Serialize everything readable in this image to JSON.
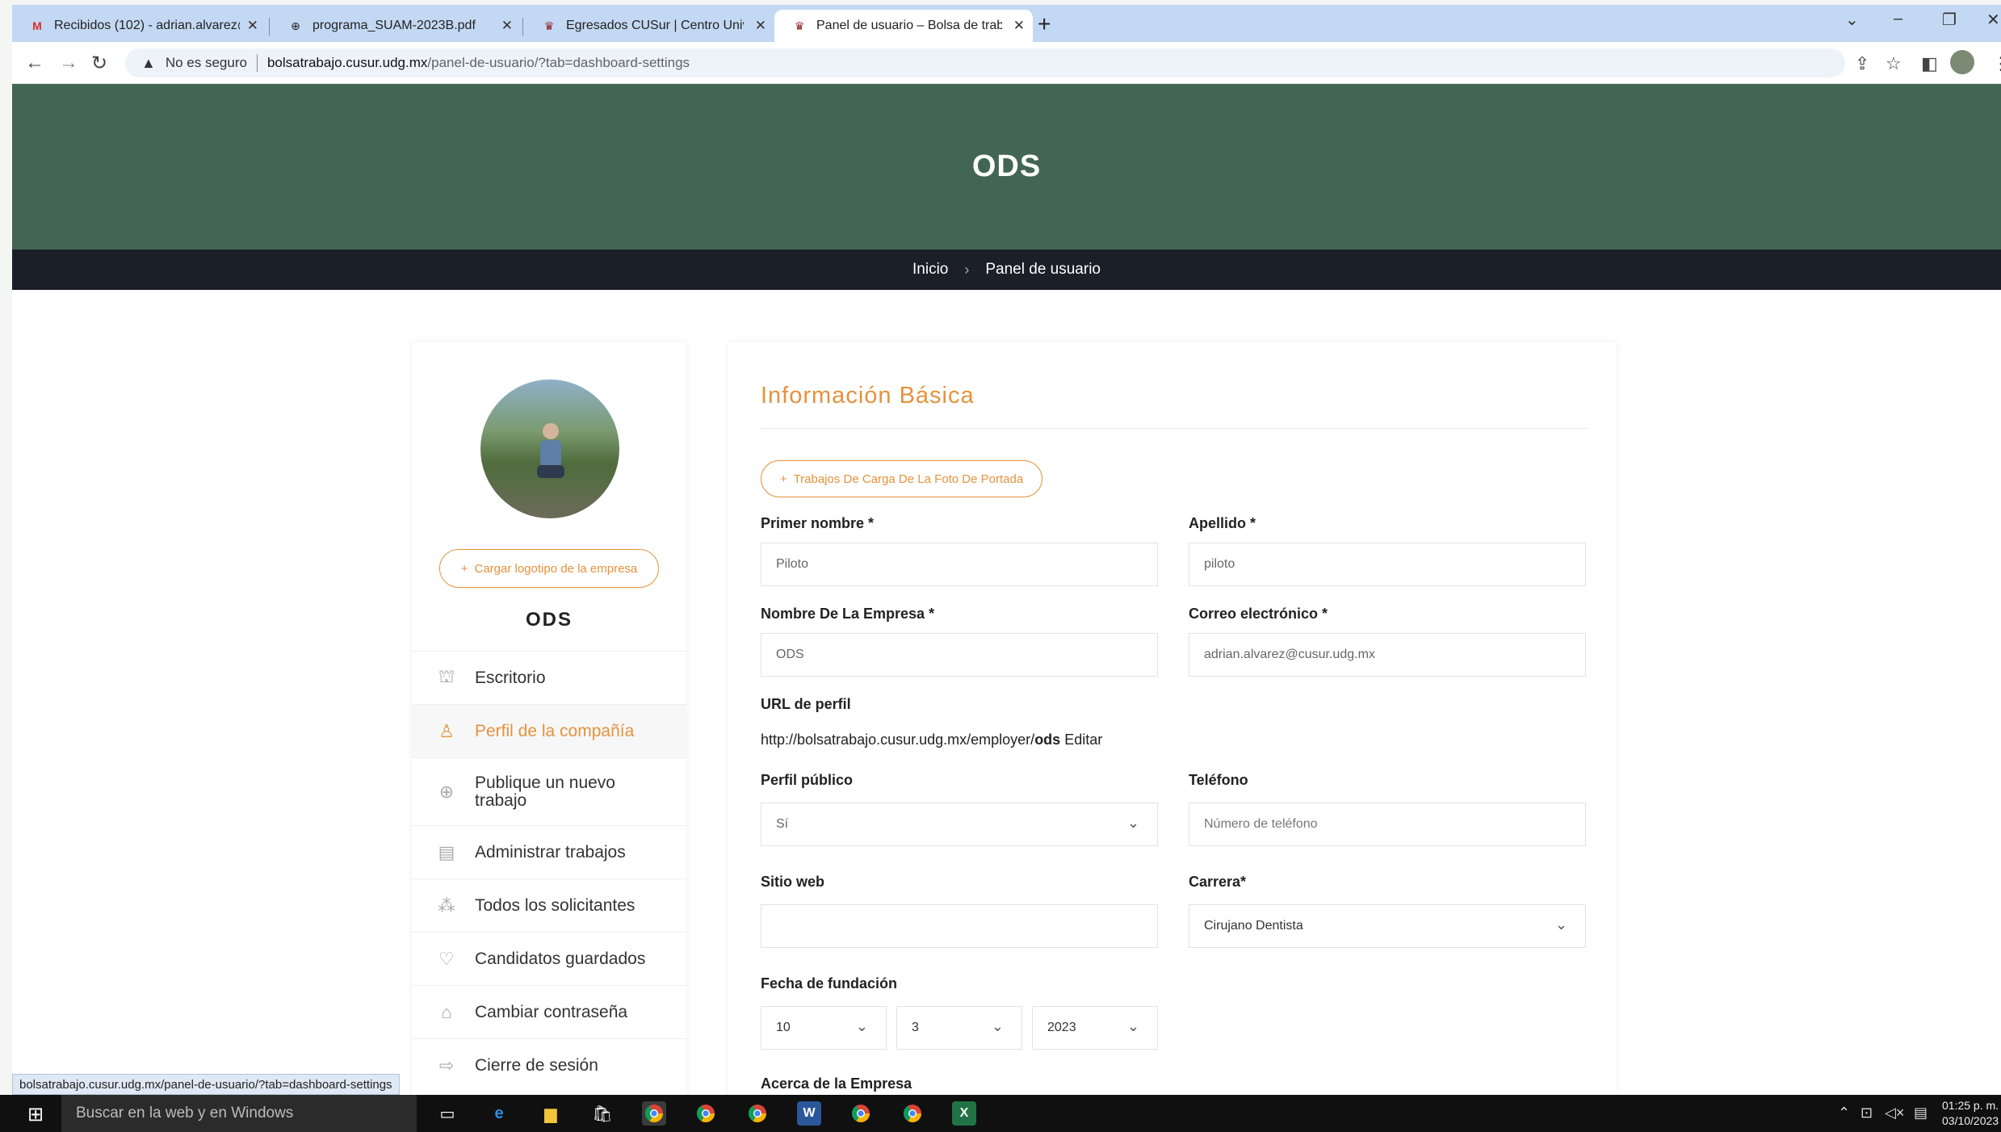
{
  "browser": {
    "tabs": [
      {
        "title": "Recibidos (102) - adrian.alvarez@",
        "icon": "gmail-icon"
      },
      {
        "title": "programa_SUAM-2023B.pdf",
        "icon": "globe-icon"
      },
      {
        "title": "Egresados CUSur | Centro Unive",
        "icon": "udg-icon"
      },
      {
        "title": "Panel de usuario – Bolsa de trab",
        "icon": "udg-icon"
      }
    ],
    "new_tab": "+",
    "security": "No es seguro",
    "url_domain": "bolsatrabajo.cusur.udg.mx",
    "url_path": "/panel-de-usuario/?tab=dashboard-settings",
    "status_url": "bolsatrabajo.cusur.udg.mx/panel-de-usuario/?tab=dashboard-settings"
  },
  "site": {
    "hero_title": "ODS",
    "breadcrumb": {
      "home": "Inicio",
      "current": "Panel de usuario"
    }
  },
  "sidebar": {
    "upload_logo": "Cargar logotipo de la empresa",
    "company_name": "ODS",
    "items": [
      {
        "label": "Escritorio",
        "icon": "dashboard-icon"
      },
      {
        "label": "Perfil de la compañía",
        "icon": "user-icon"
      },
      {
        "label": "Publique un nuevo trabajo",
        "icon": "plus-circle-icon"
      },
      {
        "label": "Administrar trabajos",
        "icon": "briefcase-icon"
      },
      {
        "label": "Todos los solicitantes",
        "icon": "users-icon"
      },
      {
        "label": "Candidatos guardados",
        "icon": "heart-icon"
      },
      {
        "label": "Cambiar contraseña",
        "icon": "lock-icon"
      },
      {
        "label": "Cierre de sesión",
        "icon": "logout-icon"
      }
    ]
  },
  "form": {
    "title": "Información Básica",
    "cover_button": "Trabajos De Carga De La Foto De Portada",
    "first_name": {
      "label": "Primer nombre *",
      "value": "Piloto"
    },
    "last_name": {
      "label": "Apellido *",
      "value": "piloto"
    },
    "company": {
      "label": "Nombre De La Empresa *",
      "value": "ODS"
    },
    "email": {
      "label": "Correo electrónico *",
      "value": "adrian.alvarez@cusur.udg.mx"
    },
    "profile_url": {
      "label": "URL de perfil",
      "prefix": "http://bolsatrabajo.cusur.udg.mx/employer/",
      "slug": "ods",
      "edit": "Editar"
    },
    "public_profile": {
      "label": "Perfil público",
      "value": "Sí"
    },
    "phone": {
      "label": "Teléfono",
      "placeholder": "Número de teléfono"
    },
    "website": {
      "label": "Sitio web",
      "value": ""
    },
    "career": {
      "label": "Carrera*",
      "value": "Cirujano Dentista"
    },
    "founded": {
      "label": "Fecha de fundación",
      "day": "10",
      "month": "3",
      "year": "2023"
    },
    "about": {
      "label": "Acerca de la Empresa"
    }
  },
  "taskbar": {
    "search_placeholder": "Buscar en la web y en Windows",
    "time": "01:25 p. m.",
    "date": "03/10/2023"
  },
  "colors": {
    "accent": "#e5923d",
    "hero": "#436654",
    "breadcrumb_bg": "#1b1f27"
  }
}
